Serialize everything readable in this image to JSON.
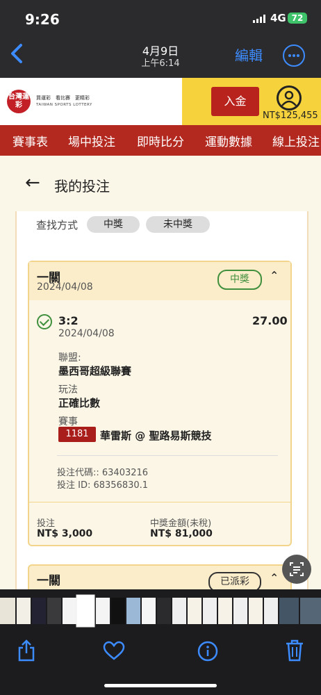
{
  "status_bar": {
    "time": "9:26",
    "network": "4G",
    "battery": "72"
  },
  "nav": {
    "date": "4月9日",
    "time": "上午6:14",
    "edit_label": "編輯"
  },
  "site": {
    "logo_text": "台灣運彩",
    "tagline": "買運彩　看比賽　更精彩",
    "tagline_en": "TAIWAN SPORTS LOTTERY",
    "deposit_label": "入金",
    "balance": "NT$125,455",
    "tabs": [
      "賽事表",
      "場中投注",
      "即時比分",
      "運動數據",
      "線上投注"
    ]
  },
  "page": {
    "title": "我的投注",
    "query_label": "查找方式",
    "filters": [
      "中獎",
      "未中獎"
    ]
  },
  "bet": {
    "type": "一關",
    "date": "2024/04/08",
    "status": "中獎",
    "selection": "3:2",
    "selection_date": "2024/04/08",
    "odds": "27.00",
    "league_label": "聯盟:",
    "league": "墨西哥超級聯賽",
    "play_label": "玩法",
    "play": "正確比數",
    "event_label": "賽事",
    "event_code": "1181",
    "event_name": "華雷斯 @ 聖路易斯競技",
    "bet_code": "投注代碼:: 63403216",
    "bet_id": "投注 ID: 68356830.1",
    "stake_label": "投注",
    "stake": "NT$ 3,000",
    "payout_label": "中獎金額(未稅)",
    "payout": "NT$ 81,000"
  },
  "bet2": {
    "type": "一關",
    "status": "已派彩"
  },
  "colors": {
    "accent_blue": "#3d8cff",
    "brand_red": "#b3291f",
    "win_green": "#3f8f3d",
    "gold": "#f6d33c"
  },
  "toolbar_icons": [
    "share-icon",
    "heart-icon",
    "info-icon",
    "trash-icon"
  ]
}
